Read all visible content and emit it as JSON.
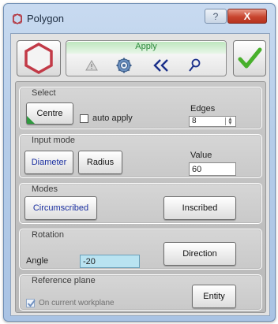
{
  "window": {
    "title": "Polygon",
    "help_symbol": "?",
    "close_symbol": "X"
  },
  "toolbar": {
    "apply_label": "Apply",
    "icons": [
      "hexagon-icon",
      "warning-icon",
      "gear-icon",
      "back-double-chevron-icon",
      "search-icon",
      "checkmark-icon"
    ],
    "colors": {
      "hexagon": "#c23a47",
      "check": "#48b02c",
      "apply_text": "#2a8a3a"
    }
  },
  "select": {
    "title": "Select",
    "centre_label": "Centre",
    "auto_apply_label": "auto apply",
    "auto_apply_checked": false,
    "edges_label": "Edges",
    "edges_value": "8"
  },
  "input_mode": {
    "title": "Input mode",
    "diameter_label": "Diameter",
    "radius_label": "Radius",
    "value_label": "Value",
    "value": "60"
  },
  "modes": {
    "title": "Modes",
    "circumscribed_label": "Circumscribed",
    "inscribed_label": "Inscribed"
  },
  "rotation": {
    "title": "Rotation",
    "angle_label": "Angle",
    "angle_value": "-20",
    "direction_label": "Direction"
  },
  "reference_plane": {
    "title": "Reference plane",
    "on_current_label": "On current workplane",
    "on_current_checked": true,
    "entity_label": "Entity"
  }
}
